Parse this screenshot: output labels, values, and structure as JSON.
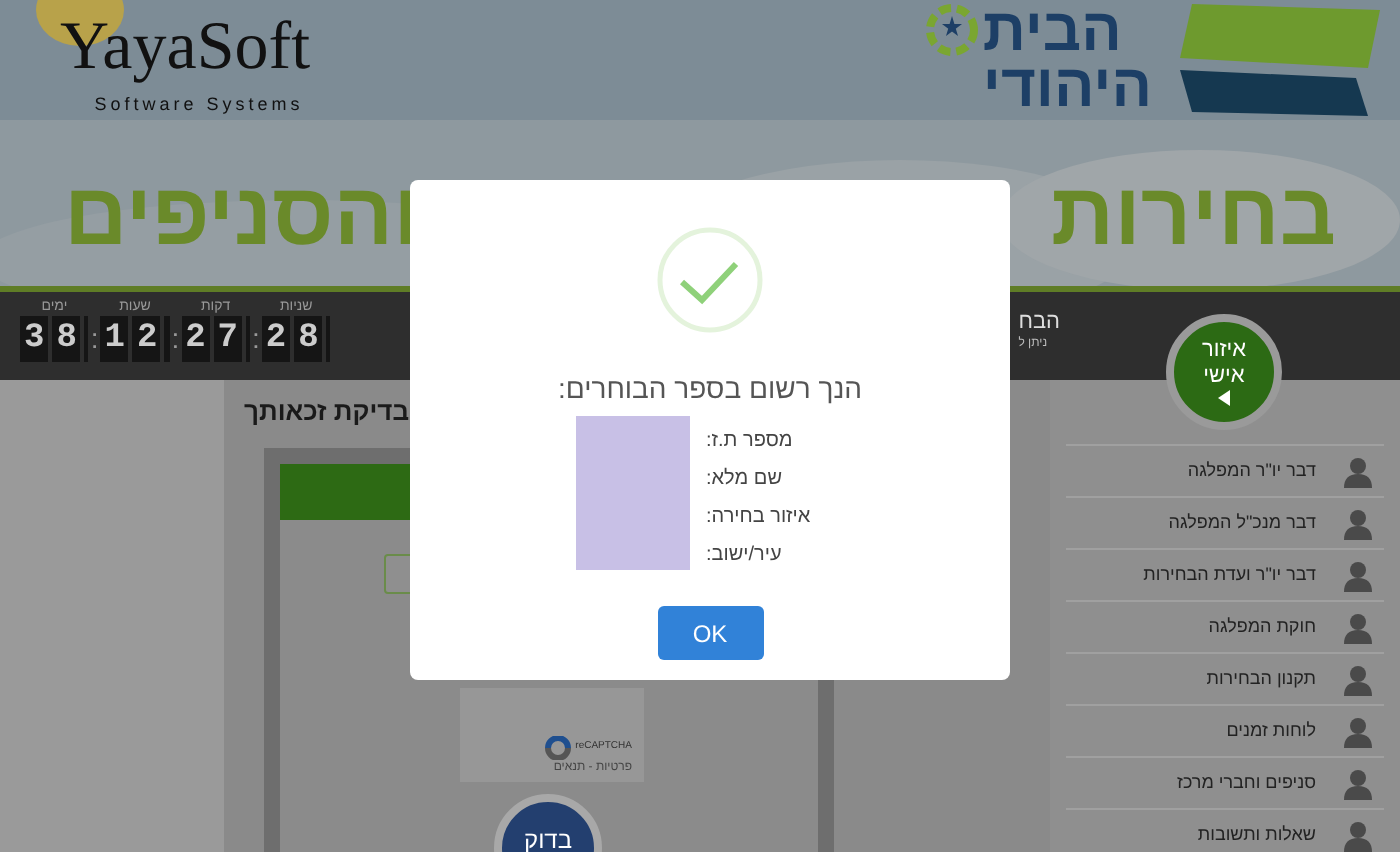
{
  "header": {
    "company_logo": {
      "name": "YayaSoft",
      "tagline": "Software Systems"
    },
    "party_logo": {
      "lines": [
        "הבית",
        "היהודי"
      ]
    },
    "headline": [
      "בחירות",
      "והסניפים"
    ]
  },
  "countdown": [
    {
      "label": "שניות",
      "value": "28",
      "separator": ":"
    },
    {
      "label": "דקות",
      "value": "27",
      "separator": ":"
    },
    {
      "label": "שעות",
      "value": "12",
      "separator": ":"
    },
    {
      "label": "ימים",
      "value": "38"
    }
  ],
  "top_bar": {
    "title": "הבח",
    "subtitle": "ניתן ל"
  },
  "personal_area": {
    "lines": [
      "איזור",
      "אישי"
    ]
  },
  "eligibility": {
    "title": "בדיקת זכאותך",
    "captcha": "reCAPTCHA",
    "captcha_footer": "פרטיות - תנאים",
    "button": "בדוק"
  },
  "sidebar": {
    "items": [
      "דבר יו\"ר המפלגה",
      "דבר מנכ\"ל המפלגה",
      "דבר יו\"ר ועדת הבחירות",
      "חוקת המפלגה",
      "תקנון הבחירות",
      "לוחות זמנים",
      "סניפים וחברי מרכז",
      "שאלות ותשובות"
    ]
  },
  "dialog": {
    "message": "הנך רשום בספר הבוחרים:",
    "fields": [
      "מספר ת.ז:",
      "שם מלא:",
      "איזור בחירה:",
      "עיר/ישוב:"
    ],
    "button": "OK"
  }
}
